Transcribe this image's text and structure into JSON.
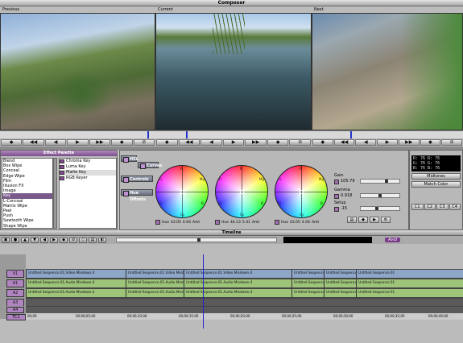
{
  "window": {
    "title": "Composer"
  },
  "monitors": [
    {
      "label": "Previous",
      "scene": "grass"
    },
    {
      "label": "Current",
      "scene": "water"
    },
    {
      "label": "Next",
      "scene": "path"
    }
  ],
  "transport": {
    "buttons": [
      "◆",
      "◀◀",
      "◀",
      "▶",
      "▶▶",
      "◆",
      "⊘"
    ]
  },
  "effect_palette": {
    "title": "Effect Palette",
    "categories": [
      "Blend",
      "Box Wipe",
      "Conceal",
      "Edge Wipe",
      "Film",
      "Illusion FX",
      "Image",
      "Key",
      "L-Conceal",
      "Matrix Wipe",
      "Peel",
      "Push",
      "Sawtooth Wipe",
      "Shape Wipe",
      "Spin"
    ],
    "selected_category": "Key",
    "effects": [
      "Chroma Key",
      "Luma Key",
      "Matte Key",
      "RGB Keyer"
    ],
    "selected_effect": "Matte Key"
  },
  "color_correction": {
    "tabs": {
      "hsl": "HSL",
      "curves": "Curves",
      "controls": "Controls",
      "hue_offsets": "Hue Offsets"
    },
    "wheels": [
      {
        "hue": "Hue",
        "v1": "43.05",
        "v2": "4.04",
        "label": "Amt"
      },
      {
        "hue": "Hue",
        "v1": "44.13",
        "v2": "5.41",
        "label": "Amt"
      },
      {
        "hue": "Hue",
        "v1": "43.05",
        "v2": "4.04",
        "label": "Amt"
      }
    ],
    "wheel_labels": {
      "r": "R",
      "mg": "Mg",
      "b": "B",
      "cy": "Cy",
      "g": "G",
      "yl": "YL"
    },
    "params": [
      {
        "name": "Gain",
        "value": "105.79"
      },
      {
        "name": "Gamma",
        "value": "0.918"
      },
      {
        "name": "Setup",
        "value": "-15"
      }
    ]
  },
  "right_panel": {
    "readout": [
      "R: 76  R: 76",
      "G: 76  G: 76",
      "B: 76  B: 76"
    ],
    "dropdown": "Midtones",
    "match_button": "Match Color",
    "channels": [
      "C1",
      "C2",
      "C3",
      "C4"
    ]
  },
  "timeline": {
    "title": "Timeline",
    "logo": "Avid",
    "tracks": [
      {
        "name": "V1",
        "type": "video",
        "color": "#8ea6c8"
      },
      {
        "name": "A1",
        "type": "audio",
        "color": "#9ec47a"
      },
      {
        "name": "A2",
        "type": "audio",
        "color": "#9ec47a"
      },
      {
        "name": "A3",
        "type": "empty",
        "color": "#5a5a5a"
      },
      {
        "name": "A4",
        "type": "empty",
        "color": "#5a5a5a"
      },
      {
        "name": "TC1",
        "type": "tc",
        "color": "#b89ac4"
      }
    ],
    "video_clips": [
      "Untitled Sequence.01.Video Mixdown.4",
      "Untitled Sequence.01.Video Mixdown.4",
      "Untitled Sequence.01.Video Mixdown.4",
      "Untitled Sequence.01",
      "Untitled Sequence.01",
      "Untitled Sequence.01"
    ],
    "audio_clips": [
      "Untitled Sequence.01.Audio Mixdown.4",
      "Untitled Sequence.01.Audio Mixdown.4",
      "Untitled Sequence.01.Audio Mixdown.4",
      "Untitled Sequence.01",
      "Untitled Sequence.01",
      "Untitled Sequence.01"
    ],
    "timecodes": [
      "00;00",
      "00;00;05;00",
      "00;00;10;00",
      "00;00;15;00",
      "00;00;20;00",
      "00;00;25;00",
      "00;00;30;00",
      "00;00;35;00",
      "00;00;40;00"
    ]
  }
}
